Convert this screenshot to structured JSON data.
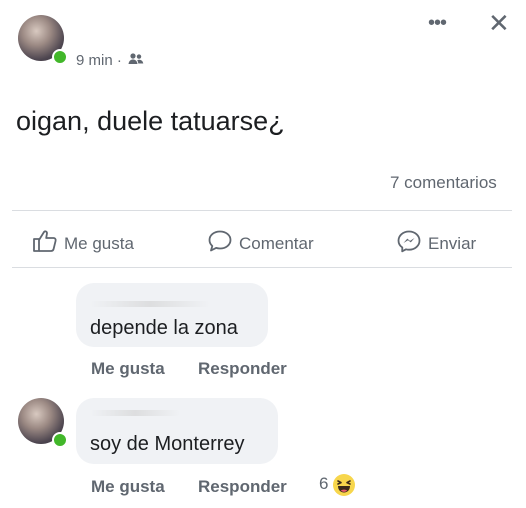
{
  "post": {
    "time": "9 min",
    "separator": "·",
    "audience_icon": "friends-icon",
    "more_icon": "•••",
    "close_icon": "✕",
    "text": "oigan, duele tatuarse¿",
    "comments_count": "7 comentarios",
    "actions": {
      "like": "Me gusta",
      "comment": "Comentar",
      "send": "Enviar"
    }
  },
  "comments": [
    {
      "text": "depende la zona",
      "like": "Me gusta",
      "reply": "Responder"
    },
    {
      "text": "soy de Monterrey",
      "like": "Me gusta",
      "reply": "Responder",
      "reactions": "6",
      "reaction_icon": "haha-icon"
    }
  ],
  "colors": {
    "online": "#42b72a",
    "meta": "#606770",
    "bubble": "#f0f2f5",
    "text": "#1c1e21"
  }
}
